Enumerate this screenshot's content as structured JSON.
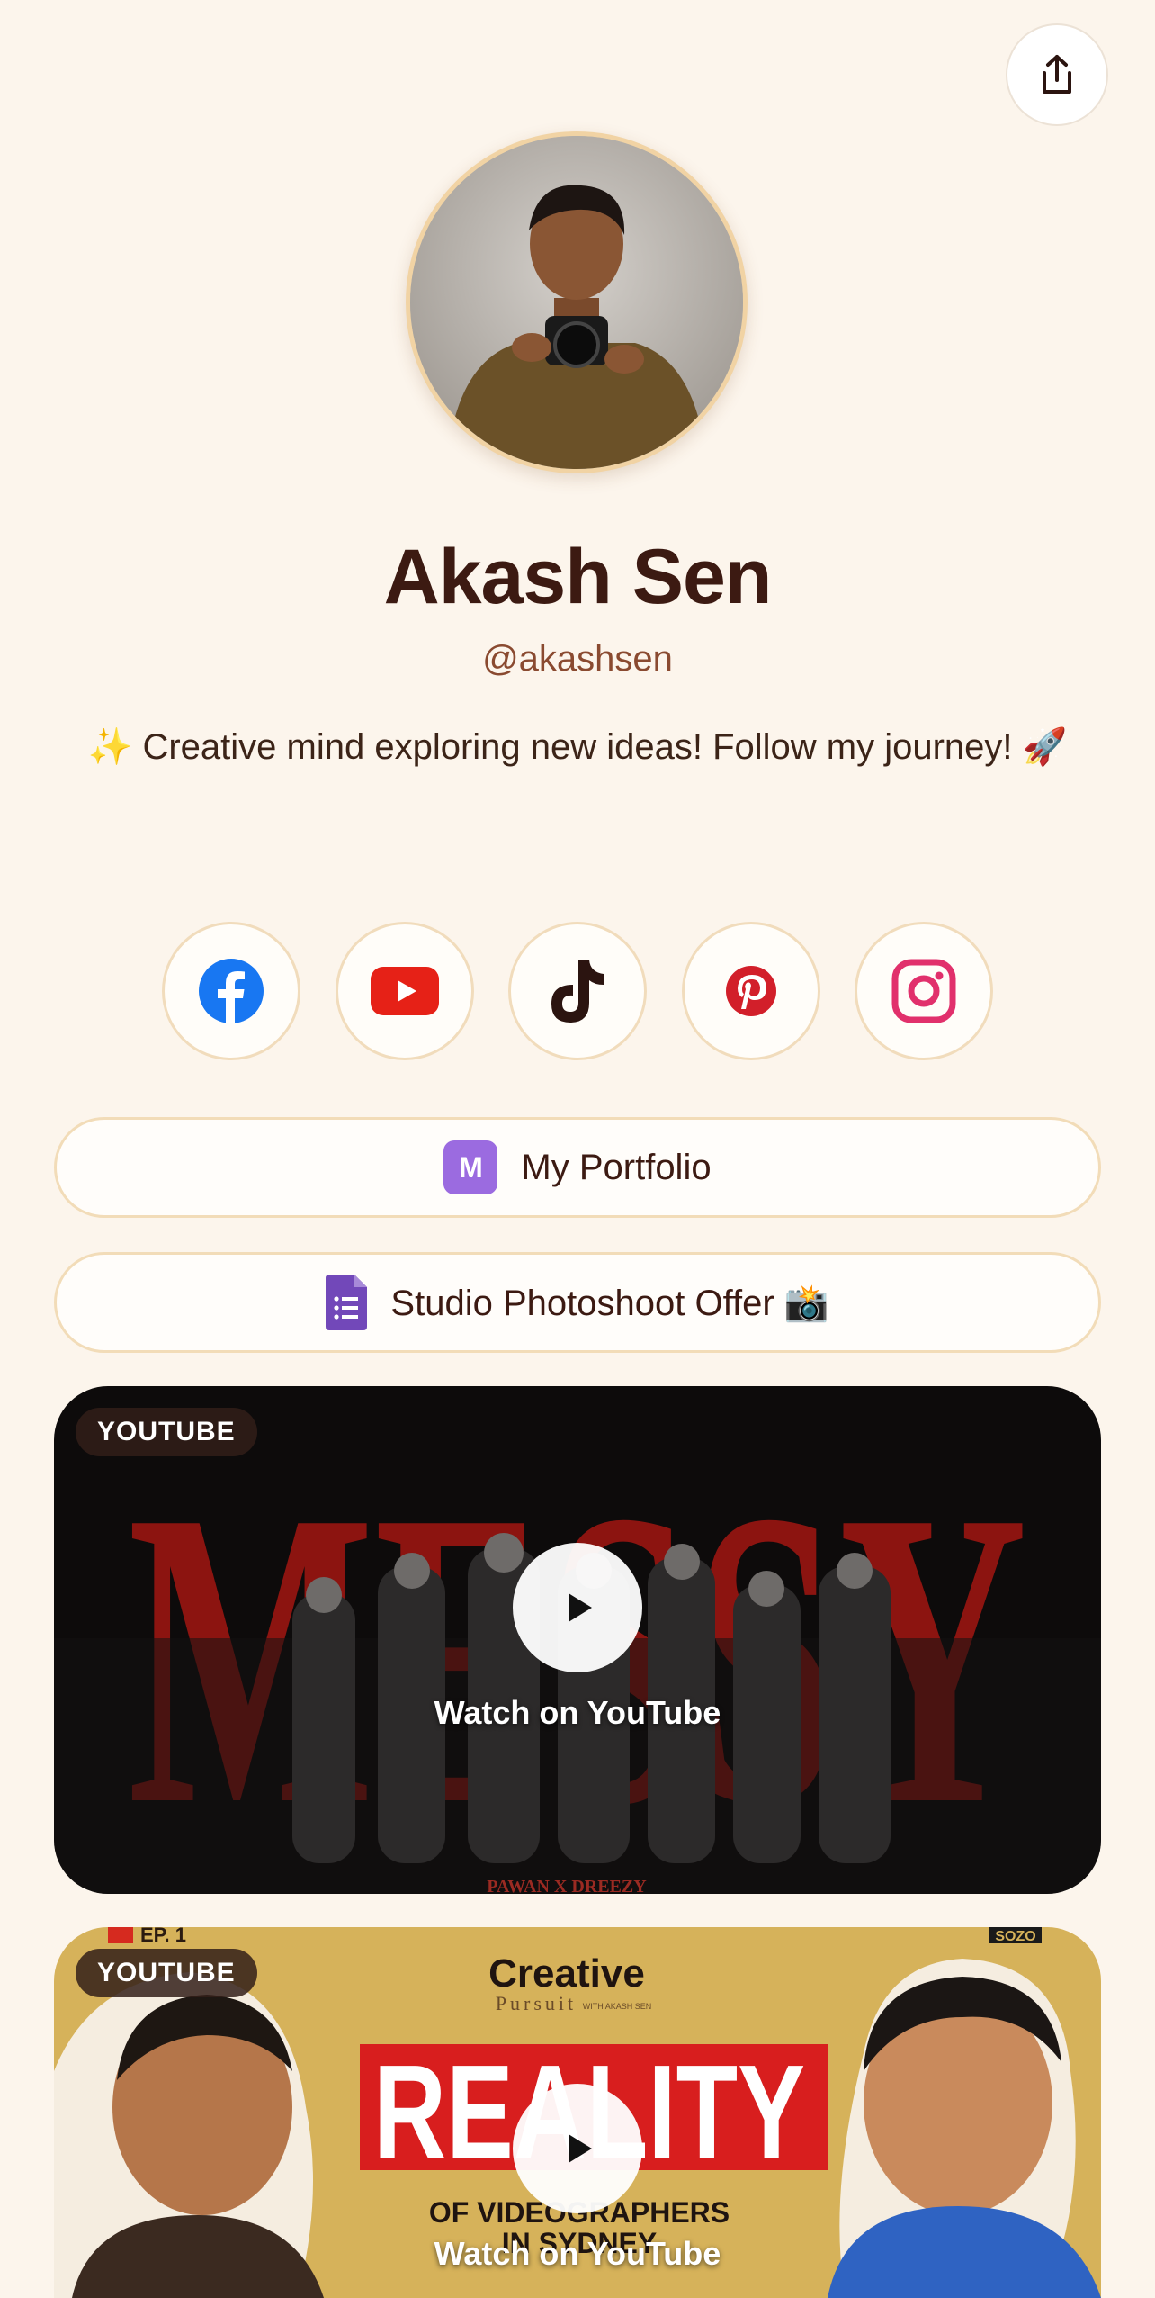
{
  "profile": {
    "name": "Akash Sen",
    "handle": "@akashsen",
    "bio": "✨ Creative mind exploring new ideas! Follow my journey! 🚀"
  },
  "socials": [
    {
      "icon": "facebook-icon",
      "color": "#1877f2"
    },
    {
      "icon": "youtube-icon",
      "color": "#e62117"
    },
    {
      "icon": "tiktok-icon",
      "color": "#2b1410"
    },
    {
      "icon": "pinterest-icon",
      "color": "#d21f2a"
    },
    {
      "icon": "instagram-icon",
      "color": "#e1306c"
    }
  ],
  "links": [
    {
      "label": "My Portfolio",
      "icon": "portfolio-m-icon",
      "icon_text": "M"
    },
    {
      "label": "Studio Photoshoot Offer 📸",
      "icon": "form-document-icon"
    }
  ],
  "videos": [
    {
      "tag": "YOUTUBE",
      "cta": "Watch on YouTube",
      "thumb_title": "MESSY",
      "thumb_caption": "PAWAN X DREEZY"
    },
    {
      "tag": "YOUTUBE",
      "cta": "Watch on YouTube",
      "thumb_title": "REALITY",
      "thumb_brand": "Creative",
      "thumb_brand_sub": "Pursuit",
      "thumb_brand_by": "WITH AKASH SEN",
      "thumb_episode": "EP. 1",
      "thumb_line1": "OF VIDEOGRAPHERS",
      "thumb_line2": "IN SYDNEY",
      "thumb_corner": "SOZO"
    }
  ],
  "colors": {
    "background": "#fcf5ec",
    "name_text": "#3c1a12",
    "handle_text": "#8a4a30",
    "border_accent": "#f2dcb8"
  }
}
